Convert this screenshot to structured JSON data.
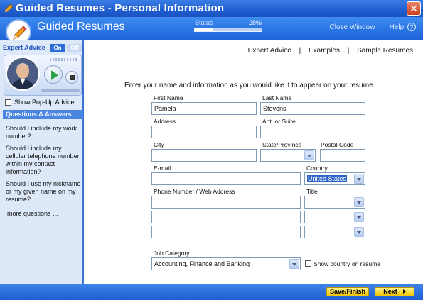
{
  "window": {
    "title": "Guided Resumes - Personal Information",
    "close_glyph": "✕"
  },
  "header": {
    "brand": "Guided Resumes",
    "status_label": "Status",
    "status_percent": "28%",
    "progress_fraction": 0.28,
    "close_window": "Close Window",
    "separator": "|",
    "help": "Help",
    "help_glyph": "?"
  },
  "sidebar": {
    "expert_advice_label": "Expert Advice",
    "on_label": "On",
    "off_label": "Off",
    "show_popup_label": "Show Pop-Up Advice",
    "qa_header": "Questions & Answers",
    "questions": [
      "Should I include my work number?",
      "Should I include my cellular telephone number within my contact information?",
      "Should I use my nickname or my given name on my resume?"
    ],
    "more_questions": "more questions ..."
  },
  "nav": {
    "expert_advice": "Expert Advice",
    "examples": "Examples",
    "sample_resumes": "Sample Resumes",
    "separator": "|"
  },
  "form": {
    "intro": "Enter your name and information as you would like it to appear on your resume.",
    "first_name_label": "First Name",
    "first_name_value": "Pamela",
    "last_name_label": "Last Name",
    "last_name_value": "Stevens",
    "address_label": "Address",
    "address_value": "",
    "apt_label": "Apt. or Suite",
    "apt_value": "",
    "city_label": "City",
    "city_value": "",
    "state_label": "State/Province",
    "state_value": "",
    "postal_label": "Postal Code",
    "postal_value": "",
    "email_label": "E-mail",
    "email_value": "",
    "country_label": "Country",
    "country_value": "United States",
    "phone_label": "Phone Number / Web Address",
    "title_label": "Title",
    "job_category_label": "Job Category",
    "job_category_value": "Accounting, Finance and Banking",
    "show_country_label": "Show country on resume"
  },
  "footer": {
    "save_finish": "Save/Finish",
    "next": "Next"
  },
  "colors": {
    "title_blue": "#1f5ed0",
    "sidebar_bg": "#dde8f8",
    "accent_yellow": "#f2c400"
  }
}
